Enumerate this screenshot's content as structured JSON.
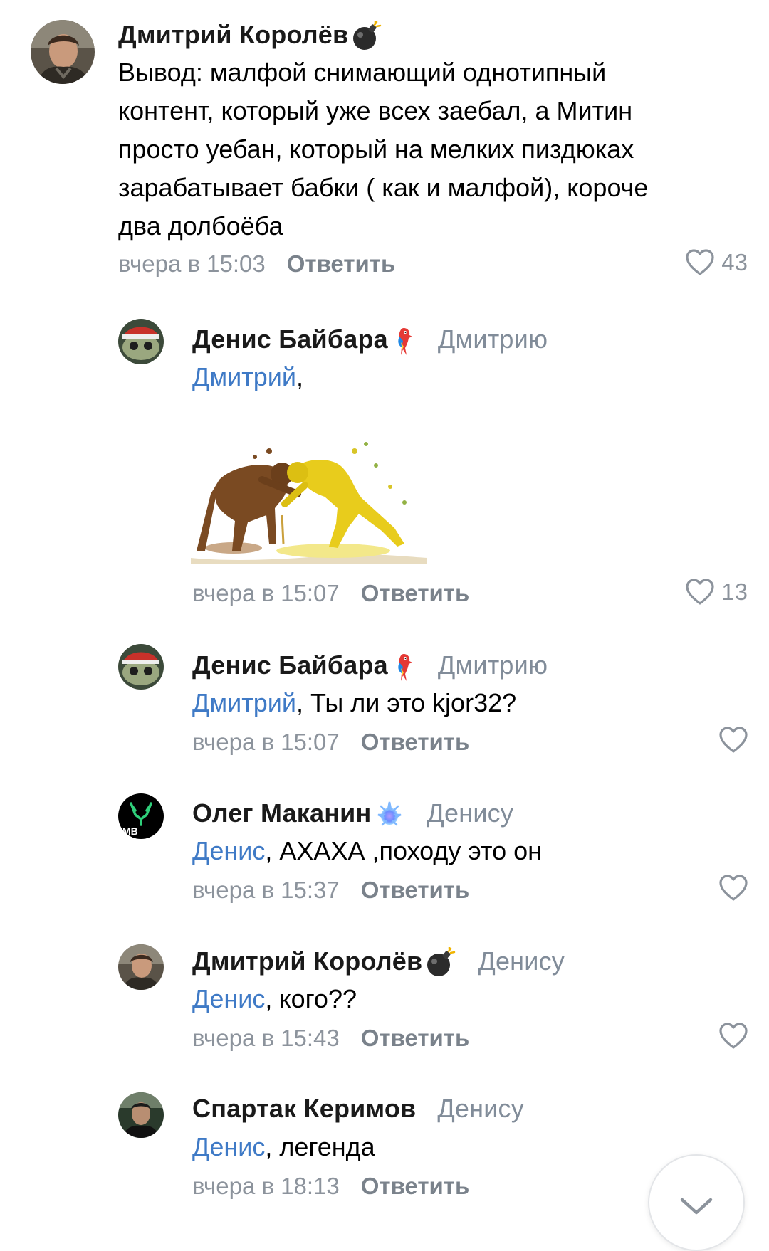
{
  "comments": [
    {
      "author": "Дмитрий Королёв",
      "badge_icon": "bomb-icon",
      "reply_to": "",
      "mention": "",
      "lines": [
        "Вывод: малфой снимающий однотипный",
        "контент, который уже всех заебал, а Митин",
        "просто уебан, который на мелких пиздюках",
        "зарабатывает бабки ( как и малфой), короче",
        "два долбоёба"
      ],
      "time": "вчера в 15:03",
      "reply_label": "Ответить",
      "likes": "43"
    },
    {
      "author": "Денис Байбара",
      "badge_icon": "parrot-icon",
      "reply_to": "Дмитрию",
      "mention": "Дмитрий",
      "text": ",",
      "sticker": "sticker-image",
      "time": "вчера в 15:07",
      "reply_label": "Ответить",
      "likes": "13"
    },
    {
      "author": "Денис Байбара",
      "badge_icon": "parrot-icon",
      "reply_to": "Дмитрию",
      "mention": "Дмитрий",
      "text": ", Ты ли это kjor32?",
      "time": "вчера в 15:07",
      "reply_label": "Ответить",
      "likes": ""
    },
    {
      "author": "Олег Маканин",
      "badge_icon": "sparkle-icon",
      "reply_to": "Денису",
      "mention": "Денис",
      "text": ", АХАХА ,походу это он",
      "time": "вчера в 15:37",
      "reply_label": "Ответить",
      "likes": ""
    },
    {
      "author": "Дмитрий Королёв",
      "badge_icon": "bomb-icon",
      "reply_to": "Денису",
      "mention": "Денис",
      "text": ", кого??",
      "time": "вчера в 15:43",
      "reply_label": "Ответить",
      "likes": ""
    },
    {
      "author": "Спартак Керимов",
      "badge_icon": "",
      "reply_to": "Денису",
      "mention": "Денис",
      "text": ", легенда",
      "time": "вчера в 18:13",
      "reply_label": "Ответить",
      "likes": ""
    }
  ],
  "colors": {
    "mention": "#3f7ac6",
    "meta": "#8c939c",
    "name": "#1a1a1a"
  },
  "icons": {
    "like": "heart-outline-icon",
    "scroll": "chevron-down-icon"
  }
}
